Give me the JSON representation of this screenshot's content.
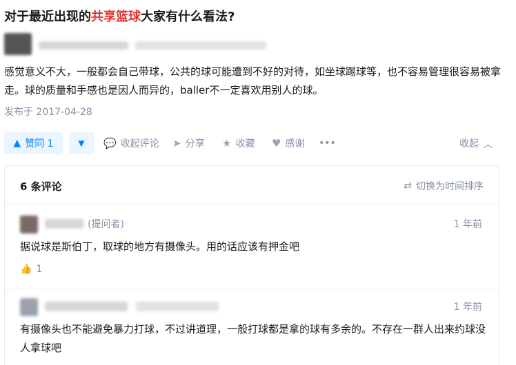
{
  "question": {
    "title_before": "对于最近出现的",
    "title_highlight": "共享篮球",
    "title_after": "大家有什么看法?",
    "highlight_color": "#e1342f"
  },
  "answer": {
    "text": "感觉意义不大，一般都会自己带球，公共的球可能遭到不好的对待，如坐球踢球等，也不容易管理很容易被拿走。球的质量和手感也是因人而异的，baller不一定喜欢用别人的球。",
    "publish_time": "发布于 2017-04-28"
  },
  "actions": {
    "upvote_label": "赞同 1",
    "upvote_icon": "triangle-up-icon",
    "downvote_icon": "triangle-down-icon",
    "collapse_comments": "收起评论",
    "share": "分享",
    "favorite": "收藏",
    "thanks": "感谢",
    "more": "•••",
    "collapse": "收起",
    "accent_color": "#0084ff"
  },
  "comments": {
    "count_label": "6 条评论",
    "sort_label": "切换为时间排序",
    "items": [
      {
        "asker_tag": "(提问者)",
        "time": "1 年前",
        "text": "据说球是斯伯丁，取球的地方有摄像头。用的话应该有押金吧",
        "likes": "1"
      },
      {
        "time": "1 年前",
        "text": "有摄像头也不能避免暴力打球，不过讲道理，一般打球都是拿的球有多余的。不存在一群人出来约球没人拿球吧"
      }
    ]
  }
}
